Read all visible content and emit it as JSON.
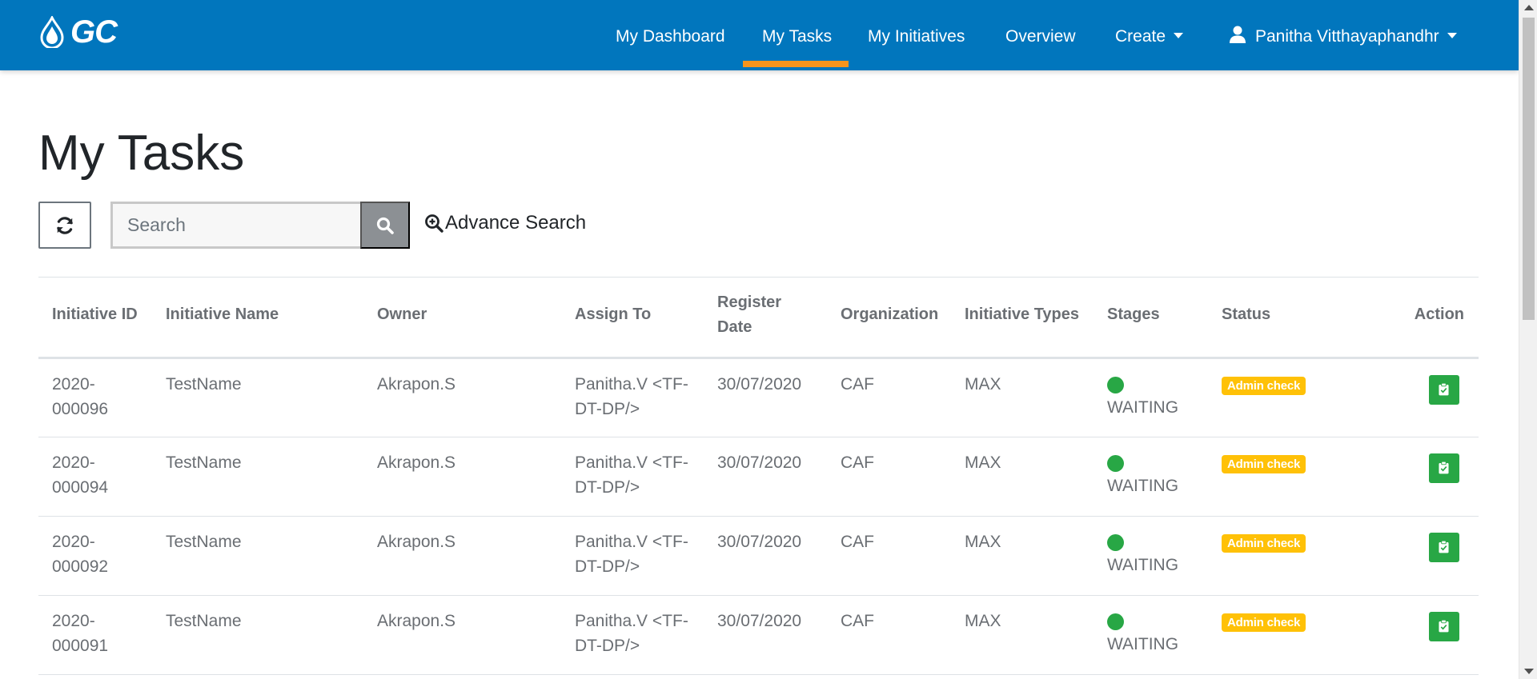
{
  "brand": {
    "logo_text": "GC",
    "navbar_color": "#0176bd",
    "accent_color": "#f7941d"
  },
  "nav": {
    "items": [
      {
        "label": "My Dashboard",
        "active": false
      },
      {
        "label": "My Tasks",
        "active": true
      },
      {
        "label": "My Initiatives",
        "active": false
      },
      {
        "label": "Overview",
        "active": false
      },
      {
        "label": "Create",
        "active": false,
        "dropdown": true
      }
    ],
    "user": {
      "name": "Panitha Vitthayaphandhr",
      "icon": "user-icon",
      "dropdown": true
    }
  },
  "page": {
    "title": "My Tasks"
  },
  "toolbar": {
    "refresh_icon": "refresh-icon",
    "search": {
      "placeholder": "Search",
      "value": ""
    },
    "search_icon": "search-icon",
    "advance_search_label": "Advance Search",
    "advance_search_icon": "zoom-in-icon"
  },
  "table": {
    "columns": [
      {
        "key": "initiative_id",
        "label": "Initiative ID"
      },
      {
        "key": "initiative_name",
        "label": "Initiative Name"
      },
      {
        "key": "owner",
        "label": "Owner"
      },
      {
        "key": "assign_to",
        "label": "Assign To"
      },
      {
        "key": "register_date",
        "label": "Register Date"
      },
      {
        "key": "organization",
        "label": "Organization"
      },
      {
        "key": "initiative_types",
        "label": "Initiative Types"
      },
      {
        "key": "stages",
        "label": "Stages"
      },
      {
        "key": "status",
        "label": "Status"
      },
      {
        "key": "action",
        "label": "Action"
      }
    ],
    "rows": [
      {
        "initiative_id": "2020-000096",
        "initiative_name": "TestName",
        "owner": "Akrapon.S",
        "assign_to": "Panitha.V <TF-DT-DP/>",
        "register_date": "30/07/2020",
        "organization": "CAF",
        "initiative_types": "MAX",
        "stage": "WAITING",
        "stage_color": "#28a745",
        "status": "Admin check",
        "status_color": "#ffc107",
        "action_icon": "clipboard-check-icon"
      },
      {
        "initiative_id": "2020-000094",
        "initiative_name": "TestName",
        "owner": "Akrapon.S",
        "assign_to": "Panitha.V <TF-DT-DP/>",
        "register_date": "30/07/2020",
        "organization": "CAF",
        "initiative_types": "MAX",
        "stage": "WAITING",
        "stage_color": "#28a745",
        "status": "Admin check",
        "status_color": "#ffc107",
        "action_icon": "clipboard-check-icon"
      },
      {
        "initiative_id": "2020-000092",
        "initiative_name": "TestName",
        "owner": "Akrapon.S",
        "assign_to": "Panitha.V <TF-DT-DP/>",
        "register_date": "30/07/2020",
        "organization": "CAF",
        "initiative_types": "MAX",
        "stage": "WAITING",
        "stage_color": "#28a745",
        "status": "Admin check",
        "status_color": "#ffc107",
        "action_icon": "clipboard-check-icon"
      },
      {
        "initiative_id": "2020-000091",
        "initiative_name": "TestName",
        "owner": "Akrapon.S",
        "assign_to": "Panitha.V <TF-DT-DP/>",
        "register_date": "30/07/2020",
        "organization": "CAF",
        "initiative_types": "MAX",
        "stage": "WAITING",
        "stage_color": "#28a745",
        "status": "Admin check",
        "status_color": "#ffc107",
        "action_icon": "clipboard-check-icon"
      }
    ]
  }
}
